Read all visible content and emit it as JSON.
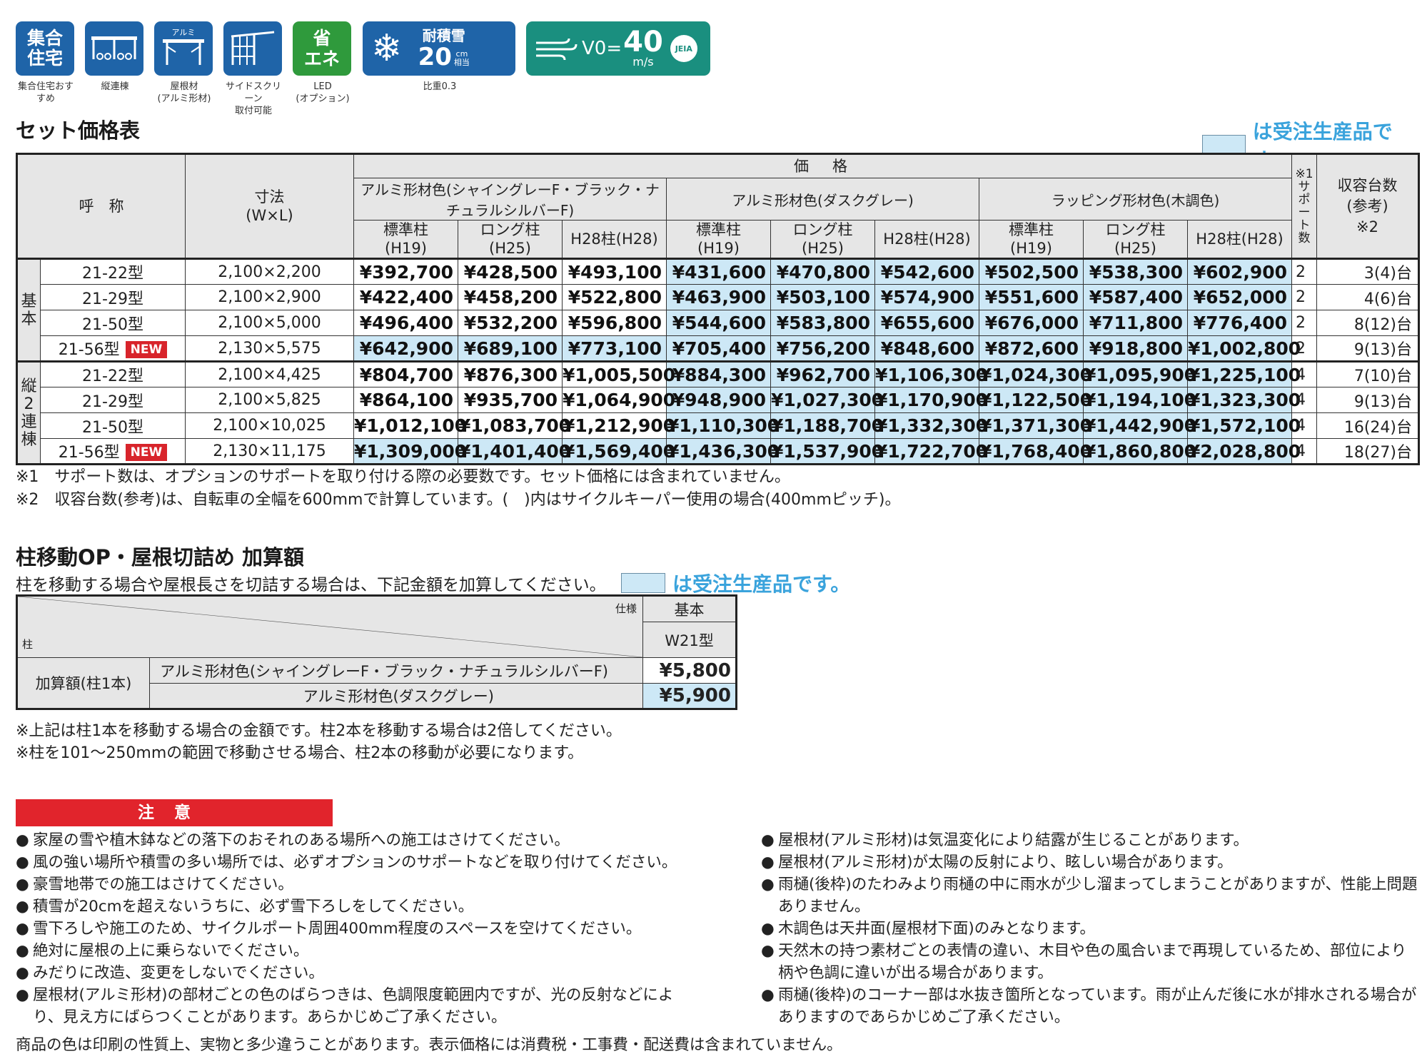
{
  "icons": [
    {
      "label": "集合\n住宅",
      "caption": "集合住宅おすすめ",
      "icon": "apartment-icon"
    },
    {
      "label": "",
      "caption": "縦連棟",
      "icon": "tandem-carport-icon"
    },
    {
      "label": "アルミ",
      "caption": "屋根材\n(アルミ形材)",
      "icon": "aluminum-roof-icon"
    },
    {
      "label": "",
      "caption": "サイドスクリーン\n取付可能",
      "icon": "side-screen-icon"
    },
    {
      "label": "省\nエネ",
      "caption": "LED\n(オプション)",
      "icon": "energy-saving-icon"
    },
    {
      "label": "耐積雪",
      "snow_value": "20",
      "snow_unit": "cm\n相当",
      "caption": "比重0.3",
      "icon": "snowflake-icon"
    },
    {
      "label": "V0=",
      "wind_value": "40",
      "wind_unit": "m/s",
      "badge": "JEIA",
      "caption": "",
      "icon": "wind-icon"
    }
  ],
  "section1": {
    "title": "セット価格表",
    "legend": "は受注生産品です。"
  },
  "price_table": {
    "h_name": "呼　称",
    "h_dim": "寸法",
    "h_dim_sub": "(W×L)",
    "h_price": "価　格",
    "h_support": "※1\nサポート数",
    "h_capacity": "収容台数\n(参考)\n※2",
    "groups": [
      "アルミ形材色(シャイングレーF・ブラック・ナチュラルシルバーF)",
      "アルミ形材色(ダスクグレー)",
      "ラッピング形材色(木調色)"
    ],
    "sub_headers": [
      "標準柱\n(H19)",
      "ロング柱\n(H25)",
      "H28柱(H28)"
    ],
    "new_label": "NEW",
    "sections": [
      {
        "label": "基\n本",
        "rows": [
          {
            "name": "21-22型",
            "is_new": false,
            "dim": "2,100×2,200",
            "prices": [
              "¥392,700",
              "¥428,500",
              "¥493,100",
              "¥431,600",
              "¥470,800",
              "¥542,600",
              "¥502,500",
              "¥538,300",
              "¥602,900"
            ],
            "bo": [
              0,
              0,
              0,
              1,
              1,
              1,
              1,
              1,
              1
            ],
            "support": "2",
            "capacity": "3(4)台"
          },
          {
            "name": "21-29型",
            "is_new": false,
            "dim": "2,100×2,900",
            "prices": [
              "¥422,400",
              "¥458,200",
              "¥522,800",
              "¥463,900",
              "¥503,100",
              "¥574,900",
              "¥551,600",
              "¥587,400",
              "¥652,000"
            ],
            "bo": [
              0,
              0,
              0,
              1,
              1,
              1,
              1,
              1,
              1
            ],
            "support": "2",
            "capacity": "4(6)台"
          },
          {
            "name": "21-50型",
            "is_new": false,
            "dim": "2,100×5,000",
            "prices": [
              "¥496,400",
              "¥532,200",
              "¥596,800",
              "¥544,600",
              "¥583,800",
              "¥655,600",
              "¥676,000",
              "¥711,800",
              "¥776,400"
            ],
            "bo": [
              0,
              0,
              0,
              1,
              1,
              1,
              1,
              1,
              1
            ],
            "support": "2",
            "capacity": "8(12)台"
          },
          {
            "name": "21-56型",
            "is_new": true,
            "dim": "2,130×5,575",
            "prices": [
              "¥642,900",
              "¥689,100",
              "¥773,100",
              "¥705,400",
              "¥756,200",
              "¥848,600",
              "¥872,600",
              "¥918,800",
              "¥1,002,800"
            ],
            "bo": [
              1,
              1,
              1,
              1,
              1,
              1,
              1,
              1,
              1
            ],
            "support": "2",
            "capacity": "9(13)台"
          }
        ]
      },
      {
        "label": "縦\n2\n連\n棟",
        "rows": [
          {
            "name": "21-22型",
            "is_new": false,
            "dim": "2,100×4,425",
            "prices": [
              "¥804,700",
              "¥876,300",
              "¥1,005,500",
              "¥884,300",
              "¥962,700",
              "¥1,106,300",
              "¥1,024,300",
              "¥1,095,900",
              "¥1,225,100"
            ],
            "bo": [
              0,
              0,
              0,
              1,
              1,
              1,
              1,
              1,
              1
            ],
            "support": "4",
            "capacity": "7(10)台"
          },
          {
            "name": "21-29型",
            "is_new": false,
            "dim": "2,100×5,825",
            "prices": [
              "¥864,100",
              "¥935,700",
              "¥1,064,900",
              "¥948,900",
              "¥1,027,300",
              "¥1,170,900",
              "¥1,122,500",
              "¥1,194,100",
              "¥1,323,300"
            ],
            "bo": [
              0,
              0,
              0,
              1,
              1,
              1,
              1,
              1,
              1
            ],
            "support": "4",
            "capacity": "9(13)台"
          },
          {
            "name": "21-50型",
            "is_new": false,
            "dim": "2,100×10,025",
            "prices": [
              "¥1,012,100",
              "¥1,083,700",
              "¥1,212,900",
              "¥1,110,300",
              "¥1,188,700",
              "¥1,332,300",
              "¥1,371,300",
              "¥1,442,900",
              "¥1,572,100"
            ],
            "bo": [
              0,
              0,
              0,
              1,
              1,
              1,
              1,
              1,
              1
            ],
            "support": "4",
            "capacity": "16(24)台"
          },
          {
            "name": "21-56型",
            "is_new": true,
            "dim": "2,130×11,175",
            "prices": [
              "¥1,309,000",
              "¥1,401,400",
              "¥1,569,400",
              "¥1,436,300",
              "¥1,537,900",
              "¥1,722,700",
              "¥1,768,400",
              "¥1,860,800",
              "¥2,028,800"
            ],
            "bo": [
              1,
              1,
              1,
              1,
              1,
              1,
              1,
              1,
              1
            ],
            "support": "4",
            "capacity": "18(27)台"
          }
        ]
      }
    ]
  },
  "notes1": [
    "※1　サポート数は、オプションのサポートを取り付ける際の必要数です。セット価格には含まれていません。",
    "※2　収容台数(参考)は、自転車の全幅を600mmで計算しています。(　)内はサイクルキーパー使用の場合(400mmピッチ)。"
  ],
  "section2": {
    "title": "柱移動OP・屋根切詰め 加算額",
    "desc": "柱を移動する場合や屋根長さを切詰する場合は、下記金額を加算してください。",
    "legend": "は受注生産品です。"
  },
  "addon_table": {
    "corner_top": "仕様",
    "corner_bottom": "柱",
    "h_basic": "基本",
    "h_model": "W21型",
    "row_label": "加算額(柱1本)",
    "rows": [
      {
        "label": "アルミ形材色(シャイングレーF・ブラック・ナチュラルシルバーF)",
        "value": "¥5,800",
        "bo": false
      },
      {
        "label": "アルミ形材色(ダスクグレー)",
        "value": "¥5,900",
        "bo": true
      }
    ]
  },
  "notes2": [
    "※上記は柱1本を移動する場合の金額です。柱2本を移動する場合は2倍してください。",
    "※柱を101～250mmの範囲で移動させる場合、柱2本の移動が必要になります。"
  ],
  "caution": {
    "title": "注意",
    "left": [
      "家屋の雪や植木鉢などの落下のおそれのある場所への施工はさけてください。",
      "風の強い場所や積雪の多い場所では、必ずオプションのサポートなどを取り付けてください。",
      "豪雪地帯での施工はさけてください。",
      "積雪が20cmを超えないうちに、必ず雪下ろしをしてください。",
      "雪下ろしや施工のため、サイクルポート周囲400mm程度のスペースを空けてください。",
      "絶対に屋根の上に乗らないでください。",
      "みだりに改造、変更をしないでください。",
      "屋根材(アルミ形材)の部材ごとの色のばらつきは、色調限度範囲内ですが、光の反射などにより、見え方にばらつくことがあります。あらかじめご了承ください。"
    ],
    "right": [
      "屋根材(アルミ形材)は気温変化により結露が生じることがあります。",
      "屋根材(アルミ形材)が太陽の反射により、眩しい場合があります。",
      "雨樋(後枠)のたわみより雨樋の中に雨水が少し溜まってしまうことがありますが、性能上問題ありません。",
      "木調色は天井面(屋根材下面)のみとなります。",
      "天然木の持つ素材ごとの表情の違い、木目や色の風合いまで再現しているため、部位により柄や色調に違いが出る場合があります。",
      "雨樋(後枠)のコーナー部は水抜き箇所となっています。雨が止んだ後に水が排水される場合がありますのであらかじめご了承ください。"
    ],
    "bullet": "●"
  },
  "footer": "商品の色は印刷の性質上、実物と多少違うことがあります。表示価格には消費税・工事費・配送費は含まれていません。",
  "colors": {
    "bo_fill": "#cde8f6",
    "header_fill": "#e6e6e6",
    "accent_blue": "#3aa3dc",
    "caution_red": "#e1242c",
    "icon_blue": "#1f64a8"
  }
}
